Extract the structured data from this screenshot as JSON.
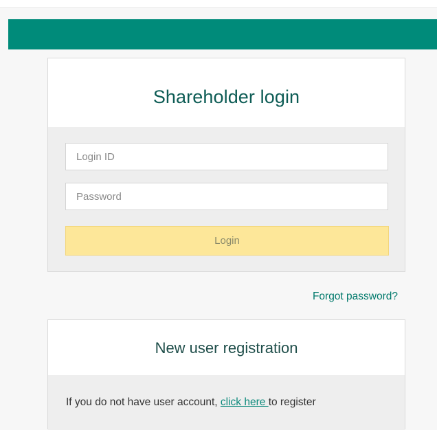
{
  "colors": {
    "header_bar": "#008b7a",
    "title_text": "#0d5c55",
    "login_button_bg": "#fde799",
    "link": "#00796b"
  },
  "login": {
    "title": "Shareholder login",
    "login_id_placeholder": "Login ID",
    "password_placeholder": "Password",
    "button_label": "Login"
  },
  "forgot_password": "Forgot password?",
  "registration": {
    "title": "New user registration",
    "text_before": "If you do not have user account, ",
    "link_text": "click here ",
    "text_after": "to register"
  }
}
